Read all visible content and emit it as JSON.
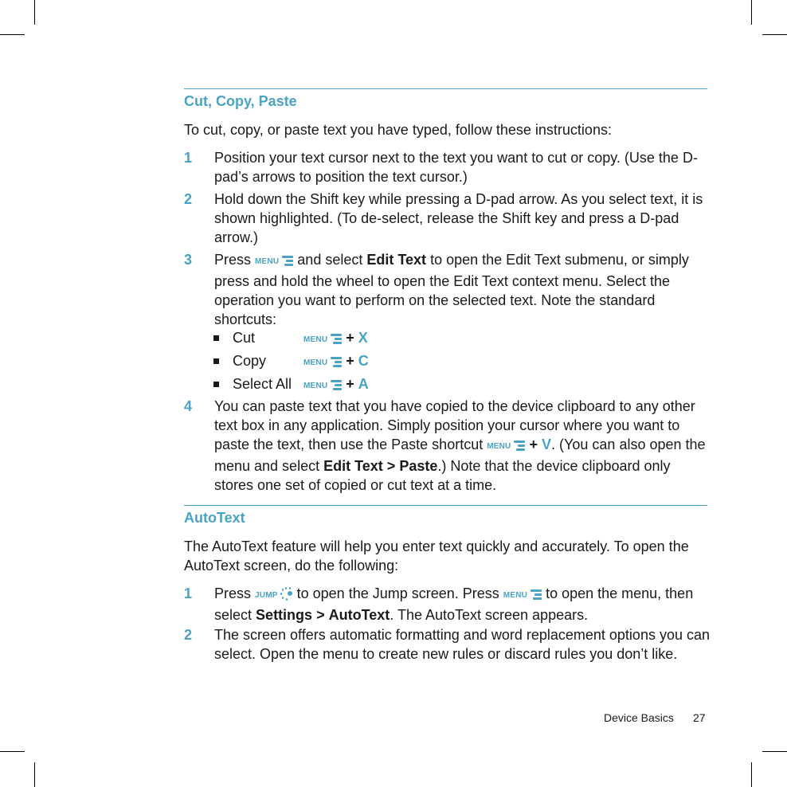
{
  "section1": {
    "heading": "Cut, Copy, Paste",
    "intro": "To cut, copy, or paste text you have typed, follow these instructions:",
    "steps": [
      {
        "num": "1",
        "text": "Position your text cursor next to the text you want to cut or copy. (Use the D-pad’s arrows to position the text cursor.)"
      },
      {
        "num": "2",
        "text": "Hold down the Shift key while pressing a D-pad arrow. As you select text, it is shown highlighted. (To de-select, release the Shift key and press a D-pad arrow.)"
      },
      {
        "num": "3",
        "pre": "Press",
        "mid": "and select",
        "bold": "Edit Text",
        "post": "to open the Edit Text submenu, or simply press and hold the wheel to open the Edit Text context menu. Select the operation you want to perform on the selected text. Note the standard shortcuts:"
      },
      {
        "num": "4",
        "pre": "You can paste text that you have copied to the device clipboard to any other text box in any application. Simply position your cursor where you want to paste the text, then use the Paste shortcut",
        "key": "V",
        "post1": ". (You can also open the menu and select",
        "bold1": "Edit Text",
        "sep": ">",
        "bold2": "Paste",
        "post2": ".) Note that the device clipboard only stores one set of copied or cut text at a time."
      }
    ],
    "shortcuts": [
      {
        "label": "Cut",
        "key": "X"
      },
      {
        "label": "Copy",
        "key": "C"
      },
      {
        "label": "Select All",
        "key": "A"
      }
    ]
  },
  "section2": {
    "heading": "AutoText",
    "intro": "The AutoText feature will help you enter text quickly and accurately. To open the AutoText screen, do the following:",
    "steps": [
      {
        "num": "1",
        "pre": "Press",
        "mid1": "to open the Jump screen. Press",
        "mid2": "to open the menu, then select",
        "bold1": "Settings",
        "sep": ">",
        "bold2": "AutoText",
        "post": ". The AutoText screen appears."
      },
      {
        "num": "2",
        "text": "The screen offers automatic formatting and word replacement options you can select. Open the menu to create new rules or discard rules you don’t like."
      }
    ]
  },
  "keys": {
    "menu_word": "MENU",
    "jump_word": "JUMP",
    "plus": "+"
  },
  "footer": {
    "section": "Device Basics",
    "page": "27"
  },
  "colors": {
    "accent": "#4aa3c4",
    "text": "#1a1a1a"
  }
}
